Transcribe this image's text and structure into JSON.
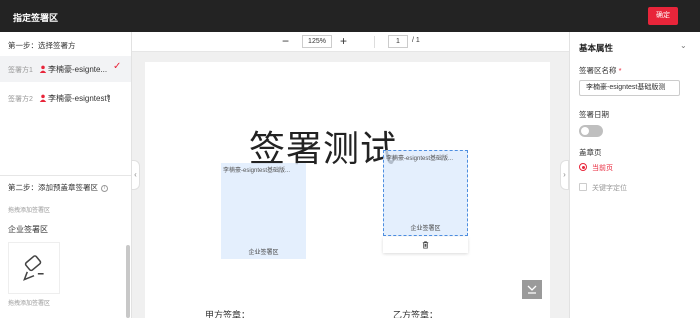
{
  "header": {
    "title": "指定签署区",
    "confirm_label": "确定"
  },
  "left_panel": {
    "step1": "第一步：选择签署方",
    "signers": [
      {
        "label": "签署方1",
        "name": "李楠豪-esignte..."
      },
      {
        "label": "签署方2",
        "name": "李楠豪-esigntest智..."
      }
    ],
    "step2": "第二步：添加预盖章签署区",
    "hint": "拖拽添加签署区",
    "company_title": "企业签署区",
    "hint2": "拖拽添加签署区"
  },
  "toolbar": {
    "minus": "−",
    "zoom": "125%",
    "plus": "+",
    "page": "1",
    "total": "/ 1"
  },
  "document": {
    "title": "签署测试",
    "areas": [
      {
        "name": "李楠豪-esigntest基础版...",
        "label": "企业签署区"
      },
      {
        "name": "李楠豪-esigntest基础版...",
        "label": "企业签署区"
      }
    ],
    "party_a": "甲方签章：",
    "party_b": "乙方签章："
  },
  "right_panel": {
    "title": "基本属性",
    "name_label": "签署区名称",
    "name_value": "李楠豪-esigntest基础版测",
    "date_label": "签署日期",
    "page_label": "盖章页",
    "current_page": "当前页",
    "keyword": "关键字定位"
  },
  "colors": {
    "accent": "#e8253a",
    "area_fill": "#dcebfc",
    "topbar": "#232323"
  }
}
